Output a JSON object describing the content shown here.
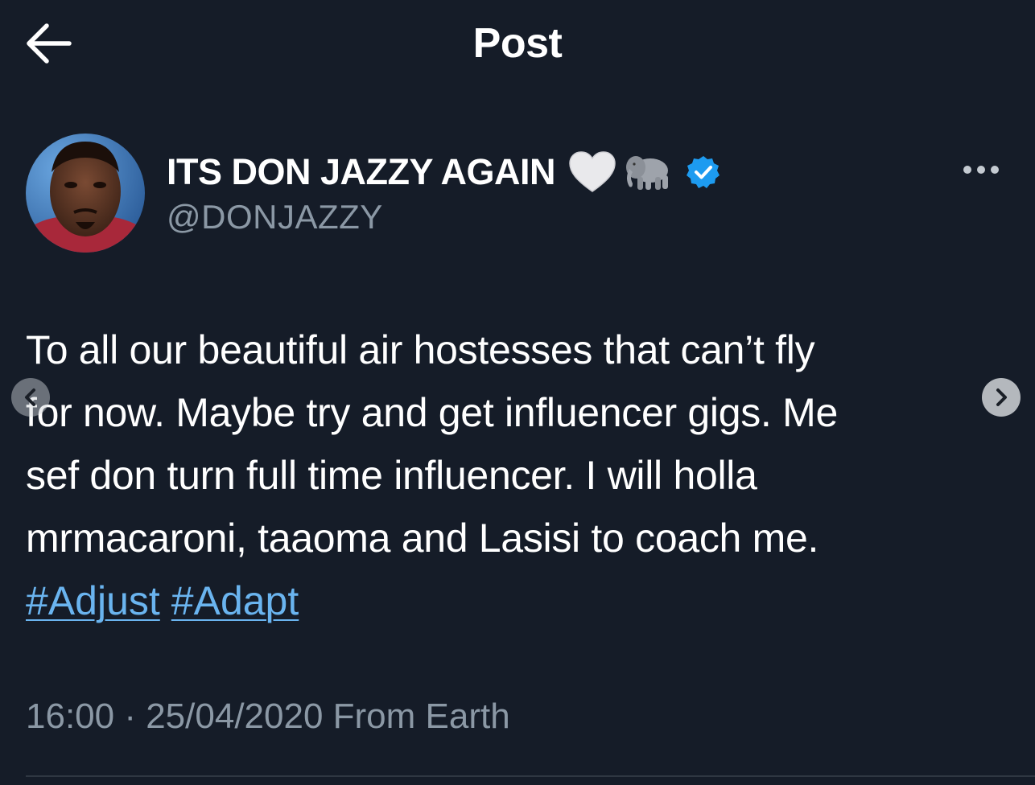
{
  "header": {
    "title": "Post",
    "back_icon": "arrow-left-icon"
  },
  "author": {
    "display_name": "ITS DON JAZZY AGAIN",
    "name_emojis": [
      "white-heart-emoji",
      "elephant-emoji"
    ],
    "verified": true,
    "handle": "@DONJAZZY",
    "avatar": "avatar-photo"
  },
  "post": {
    "text_lines": [
      "To all our beautiful air hostesses that can’t fly",
      "for now. Maybe try and get influencer gigs. Me",
      "sef don turn full time influencer. I will holla",
      "mrmacaroni, taaoma and Lasisi to coach me."
    ],
    "hashtags": [
      "#Adjust",
      "#Adapt"
    ],
    "timestamp": "16:00 · 25/04/2020 From Earth"
  },
  "colors": {
    "background": "#151c28",
    "text": "#ffffff",
    "secondary_text": "#8b98a5",
    "link": "#6ab4ef",
    "verified_badge": "#1d9bf0"
  }
}
